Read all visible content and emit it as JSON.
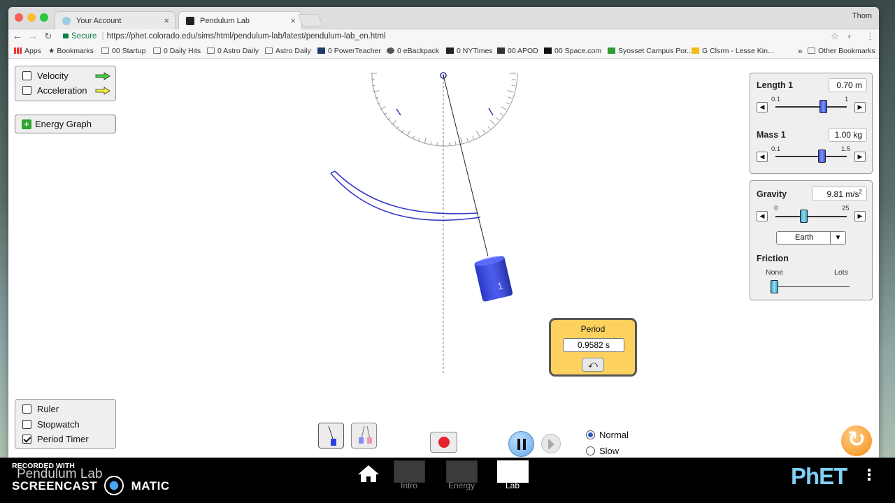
{
  "browser": {
    "user": "Thom",
    "tabs": [
      {
        "label": "Your Account",
        "close": "×"
      },
      {
        "label": "Pendulum Lab",
        "close": "×"
      }
    ],
    "url_secure": "Secure",
    "url": "https://phet.colorado.edu/sims/html/pendulum-lab/latest/pendulum-lab_en.html",
    "bookmarks": [
      "Apps",
      "Bookmarks",
      "00 Startup",
      "0 Daily Hits",
      "0 Astro Daily",
      "Astro Daily",
      "0 PowerTeacher",
      "0 eBackpack",
      "0 NYTimes",
      "00 APOD",
      "00 Space.com",
      "Syosset Campus Por...",
      "G Clsrm - Lesse Kin..."
    ],
    "overflow": "»",
    "other_bookmarks": "Other Bookmarks"
  },
  "vectors": {
    "velocity": "Velocity",
    "acceleration": "Acceleration",
    "velocity_color": "#3fd13f",
    "acceleration_color": "#f2f23a"
  },
  "energy_graph": "Energy Graph",
  "length": {
    "label": "Length 1",
    "value": "0.70 m",
    "min": "0.1",
    "max": "1",
    "fraction": 0.667
  },
  "mass": {
    "label": "Mass 1",
    "value": "1.00 kg",
    "min": "0.1",
    "max": "1.5",
    "fraction": 0.643
  },
  "gravity": {
    "label": "Gravity",
    "value": "9.81 m/s",
    "unit_sup": "2",
    "min": "0",
    "max": "25",
    "fraction": 0.392,
    "planet": "Earth"
  },
  "friction": {
    "label": "Friction",
    "min": "None",
    "max": "Lots",
    "fraction": 0.0
  },
  "period_timer": {
    "title": "Period",
    "value": "0.9582 s"
  },
  "tools": {
    "ruler": "Ruler",
    "stopwatch": "Stopwatch",
    "period_timer": "Period Timer"
  },
  "speed": {
    "normal": "Normal",
    "slow": "Slow",
    "selected": "Normal"
  },
  "screens": [
    "Intro",
    "Energy",
    "Lab"
  ],
  "active_screen": "Lab",
  "watermark": {
    "title": "Pendulum Lab",
    "line1": "RECORDED WITH",
    "line2a": "SCREENCAST",
    "line2b": "MATIC"
  },
  "brand": "PhET",
  "pendulum": {
    "mass_label": "1",
    "color": "#2f3fd6"
  }
}
